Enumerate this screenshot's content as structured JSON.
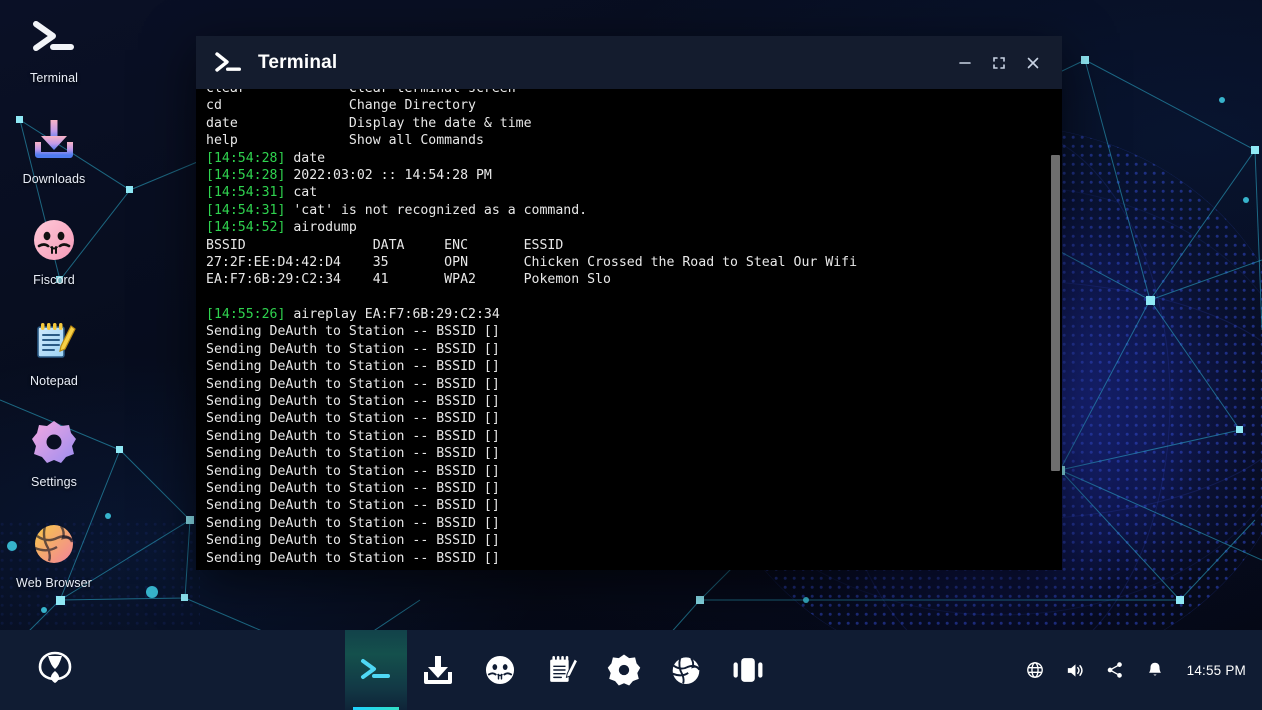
{
  "desktop": {
    "icons": [
      {
        "label": "Terminal",
        "icon": "terminal-prompt-icon"
      },
      {
        "label": "Downloads",
        "icon": "download-arrow-icon"
      },
      {
        "label": "Fiscord",
        "icon": "fiscord-face-icon"
      },
      {
        "label": "Notepad",
        "icon": "notepad-pencil-icon"
      },
      {
        "label": "Settings",
        "icon": "gear-icon"
      },
      {
        "label": "Web Browser",
        "icon": "globe-icon"
      }
    ]
  },
  "window": {
    "title": "Terminal",
    "title_icon": "terminal-prompt-icon",
    "controls": {
      "minimize": "minimize-icon",
      "maximize": "maximize-icon",
      "close": "close-icon"
    }
  },
  "terminal": {
    "help_rows": [
      {
        "cmd": "clear",
        "desc": "Clear terminal screen"
      },
      {
        "cmd": "cd",
        "desc": "Change Directory"
      },
      {
        "cmd": "date",
        "desc": "Display the date & time"
      },
      {
        "cmd": "help",
        "desc": "Show all Commands"
      }
    ],
    "log": [
      {
        "ts": "[14:54:28]",
        "text": "date"
      },
      {
        "ts": "[14:54:28]",
        "text": "2022:03:02 :: 14:54:28 PM"
      },
      {
        "ts": "[14:54:31]",
        "text": "cat"
      },
      {
        "ts": "[14:54:31]",
        "text": "'cat' is not recognized as a command."
      },
      {
        "ts": "[14:54:52]",
        "text": "airodump"
      }
    ],
    "airodump": {
      "headers": [
        "BSSID",
        "DATA",
        "ENC",
        "ESSID"
      ],
      "rows": [
        {
          "bssid": "27:2F:EE:D4:42:D4",
          "data": "35",
          "enc": "OPN",
          "essid": "Chicken Crossed the Road to Steal Our Wifi"
        },
        {
          "bssid": "EA:F7:6B:29:C2:34",
          "data": "41",
          "enc": "WPA2",
          "essid": "Pokemon Slo"
        }
      ]
    },
    "aireplay": {
      "ts": "[14:55:26]",
      "command": "aireplay EA:F7:6B:29:C2:34",
      "output_line": "Sending DeAuth to Station -- BSSID []",
      "output_count": 14
    },
    "colors": {
      "timestamp": "#2fd34f",
      "text": "#e8e8e8",
      "background": "#000000"
    }
  },
  "taskbar": {
    "start_icon": "start-logo-icon",
    "items": [
      {
        "label": "Terminal",
        "icon": "terminal-prompt-icon",
        "active": true
      },
      {
        "label": "Downloads",
        "icon": "download-arrow-icon",
        "active": false
      },
      {
        "label": "Fiscord",
        "icon": "fiscord-face-icon",
        "active": false
      },
      {
        "label": "Notepad",
        "icon": "notepad-pencil-icon",
        "active": false
      },
      {
        "label": "Settings",
        "icon": "gear-icon",
        "active": false
      },
      {
        "label": "Web Browser",
        "icon": "globe-icon",
        "active": false
      },
      {
        "label": "Gallery",
        "icon": "gallery-icon",
        "active": false
      }
    ],
    "tray": [
      {
        "name": "network-icon"
      },
      {
        "name": "volume-icon"
      },
      {
        "name": "share-icon"
      },
      {
        "name": "notifications-bell-icon"
      }
    ],
    "clock": "14:55 PM"
  }
}
